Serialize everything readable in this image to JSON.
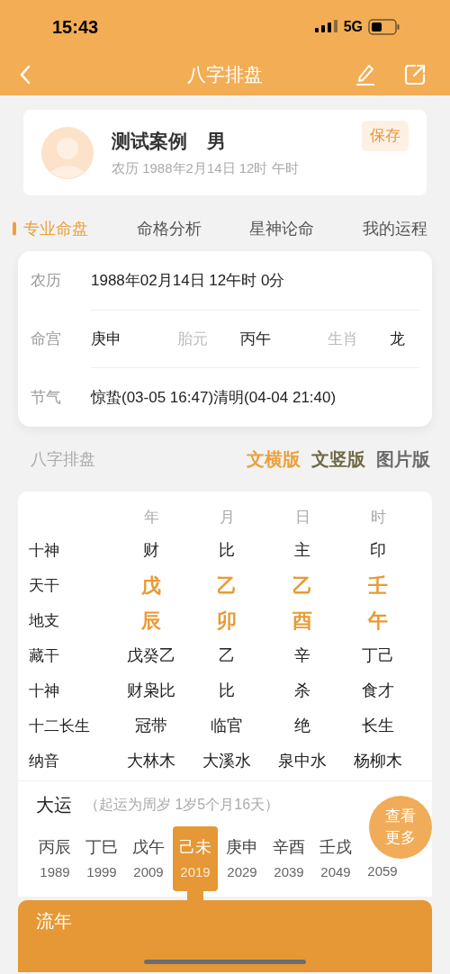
{
  "status_bar": {
    "time": "15:43",
    "network": "5G"
  },
  "nav": {
    "title": "八字排盘"
  },
  "profile": {
    "name": "测试案例",
    "gender": "男",
    "subtitle": "农历 1988年2月14日 12时 午时",
    "save_label": "保存"
  },
  "tabs": [
    {
      "label": "专业命盘",
      "selected": true
    },
    {
      "label": "命格分析",
      "selected": false
    },
    {
      "label": "星神论命",
      "selected": false
    },
    {
      "label": "我的运程",
      "selected": false
    }
  ],
  "info": {
    "lunar": {
      "label": "农历",
      "value": "1988年02月14日 12午时 0分"
    },
    "palace": [
      {
        "label": "命宫",
        "value": "庚申"
      },
      {
        "label": "胎元",
        "value": "丙午"
      },
      {
        "label": "生肖",
        "value": "龙"
      }
    ],
    "solar_terms": {
      "label": "节气",
      "value": "惊蛰(03-05 16:47)清明(04-04 21:40)"
    }
  },
  "section": {
    "title": "八字排盘",
    "views": [
      {
        "label": "文横版",
        "color": "#eaa13e"
      },
      {
        "label": "文竖版",
        "color": "#6f6a45"
      },
      {
        "label": "图片版",
        "color": "#6b6b6b"
      }
    ]
  },
  "chart": {
    "columns": [
      "年",
      "月",
      "日",
      "时"
    ],
    "rows": [
      {
        "label": "十神",
        "highlight": false,
        "cells": [
          "财",
          "比",
          "主",
          "印"
        ]
      },
      {
        "label": "天干",
        "highlight": true,
        "cells": [
          "戊",
          "乙",
          "乙",
          "壬"
        ]
      },
      {
        "label": "地支",
        "highlight": true,
        "cells": [
          "辰",
          "卯",
          "酉",
          "午"
        ]
      },
      {
        "label": "藏干",
        "highlight": false,
        "cells": [
          "戊癸乙",
          "乙",
          "辛",
          "丁己"
        ]
      },
      {
        "label": "十神",
        "highlight": false,
        "cells": [
          "财枭比",
          "比",
          "杀",
          "食才"
        ]
      },
      {
        "label": "十二长生",
        "highlight": false,
        "cells": [
          "冠带",
          "临官",
          "绝",
          "长生"
        ]
      },
      {
        "label": "纳音",
        "highlight": false,
        "cells": [
          "大林木",
          "大溪水",
          "泉中水",
          "杨柳木"
        ]
      }
    ]
  },
  "dayun": {
    "title": "大运",
    "note": "（起运为周岁 1岁5个月16天）",
    "more_label": "查看更多",
    "items": [
      {
        "ganzhi": "丙辰",
        "year": "1989",
        "selected": false
      },
      {
        "ganzhi": "丁巳",
        "year": "1999",
        "selected": false
      },
      {
        "ganzhi": "戊午",
        "year": "2009",
        "selected": false
      },
      {
        "ganzhi": "己未",
        "year": "2019",
        "selected": true
      },
      {
        "ganzhi": "庚申",
        "year": "2029",
        "selected": false
      },
      {
        "ganzhi": "辛酉",
        "year": "2039",
        "selected": false
      },
      {
        "ganzhi": "壬戌",
        "year": "2049",
        "selected": false
      },
      {
        "year": "2059",
        "selected": false
      }
    ]
  },
  "liunian": {
    "title": "流年"
  }
}
